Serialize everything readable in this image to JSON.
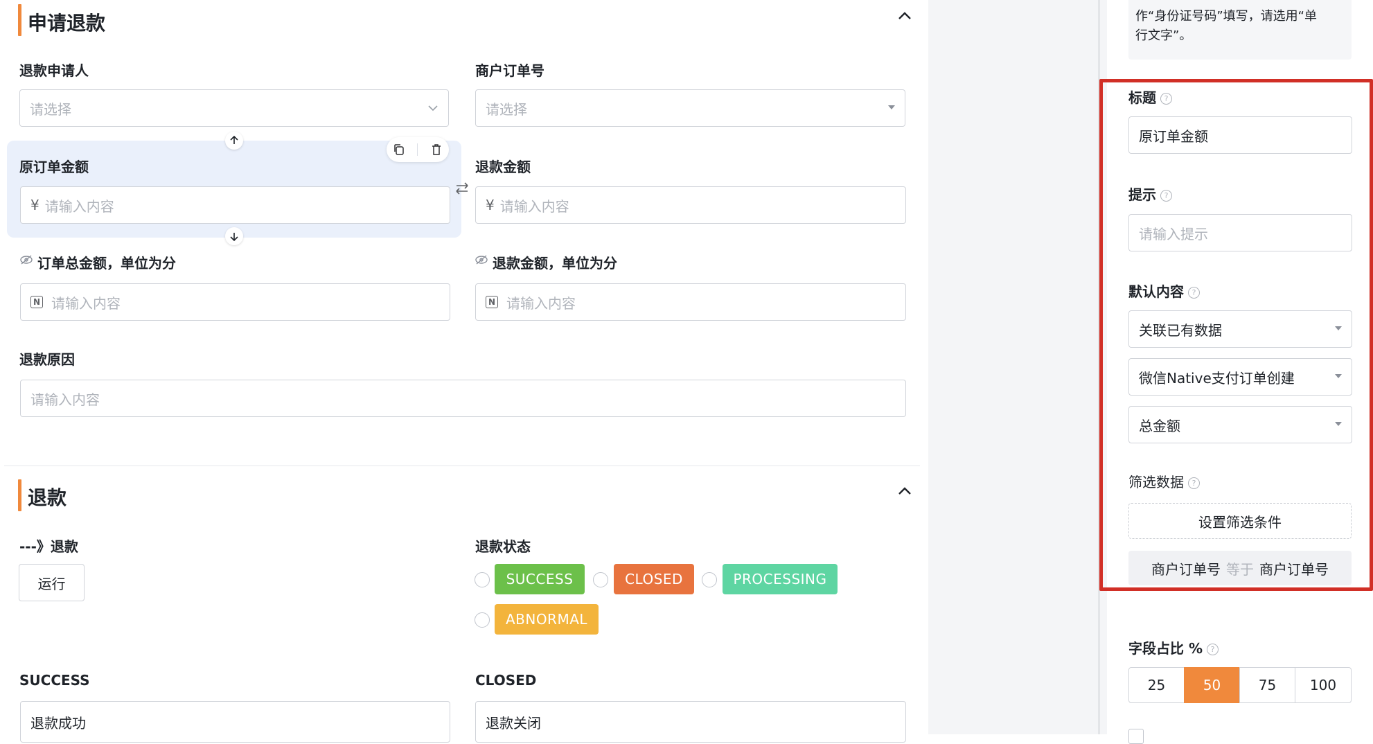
{
  "colors": {
    "accent": "#f0893c",
    "success": "#6cc04a",
    "closed": "#e8733e",
    "processing": "#5ed5a2",
    "abnormal": "#f3b43c",
    "highlight_frame": "#d12f26",
    "selected_bg": "#eaf0fb"
  },
  "section1": {
    "title": "申请退款",
    "applicant": {
      "label": "退款申请人",
      "placeholder": "请选择"
    },
    "merchant_order": {
      "label": "商户订单号",
      "placeholder": "请选择"
    },
    "original_amount": {
      "label": "原订单金额",
      "prefix": "¥",
      "placeholder": "请输入内容"
    },
    "refund_amount": {
      "label": "退款金额",
      "prefix": "¥",
      "placeholder": "请输入内容"
    },
    "order_total_cents": {
      "label": "订单总金额，单位为分",
      "placeholder": "请输入内容"
    },
    "refund_cents": {
      "label": "退款金额，单位为分",
      "placeholder": "请输入内容"
    },
    "reason": {
      "label": "退款原因",
      "placeholder": "请输入内容"
    }
  },
  "section2": {
    "title": "退款",
    "run_label": "---》退款",
    "run_button": "运行",
    "status_label": "退款状态",
    "statuses": [
      "SUCCESS",
      "CLOSED",
      "PROCESSING",
      "ABNORMAL"
    ],
    "success_label": "SUCCESS",
    "success_value": "退款成功",
    "closed_label": "CLOSED",
    "closed_value": "退款关闭"
  },
  "panel": {
    "note_line1": "作“身份证号码”填写，请选用“单",
    "note_line2": "行文字”。",
    "title_label": "标题",
    "title_value": "原订单金额",
    "hint_label": "提示",
    "hint_placeholder": "请输入提示",
    "default_label": "默认内容",
    "default_mode": "关联已有数据",
    "default_source": "微信Native支付订单创建",
    "default_field": "总金额",
    "filter_label": "筛选数据",
    "filter_button": "设置筛选条件",
    "filter_rule": {
      "left": "商户订单号",
      "op": "等于",
      "right": "商户订单号"
    },
    "width_label": "字段占比 %",
    "width_options": [
      "25",
      "50",
      "75",
      "100"
    ],
    "width_selected": "50"
  }
}
